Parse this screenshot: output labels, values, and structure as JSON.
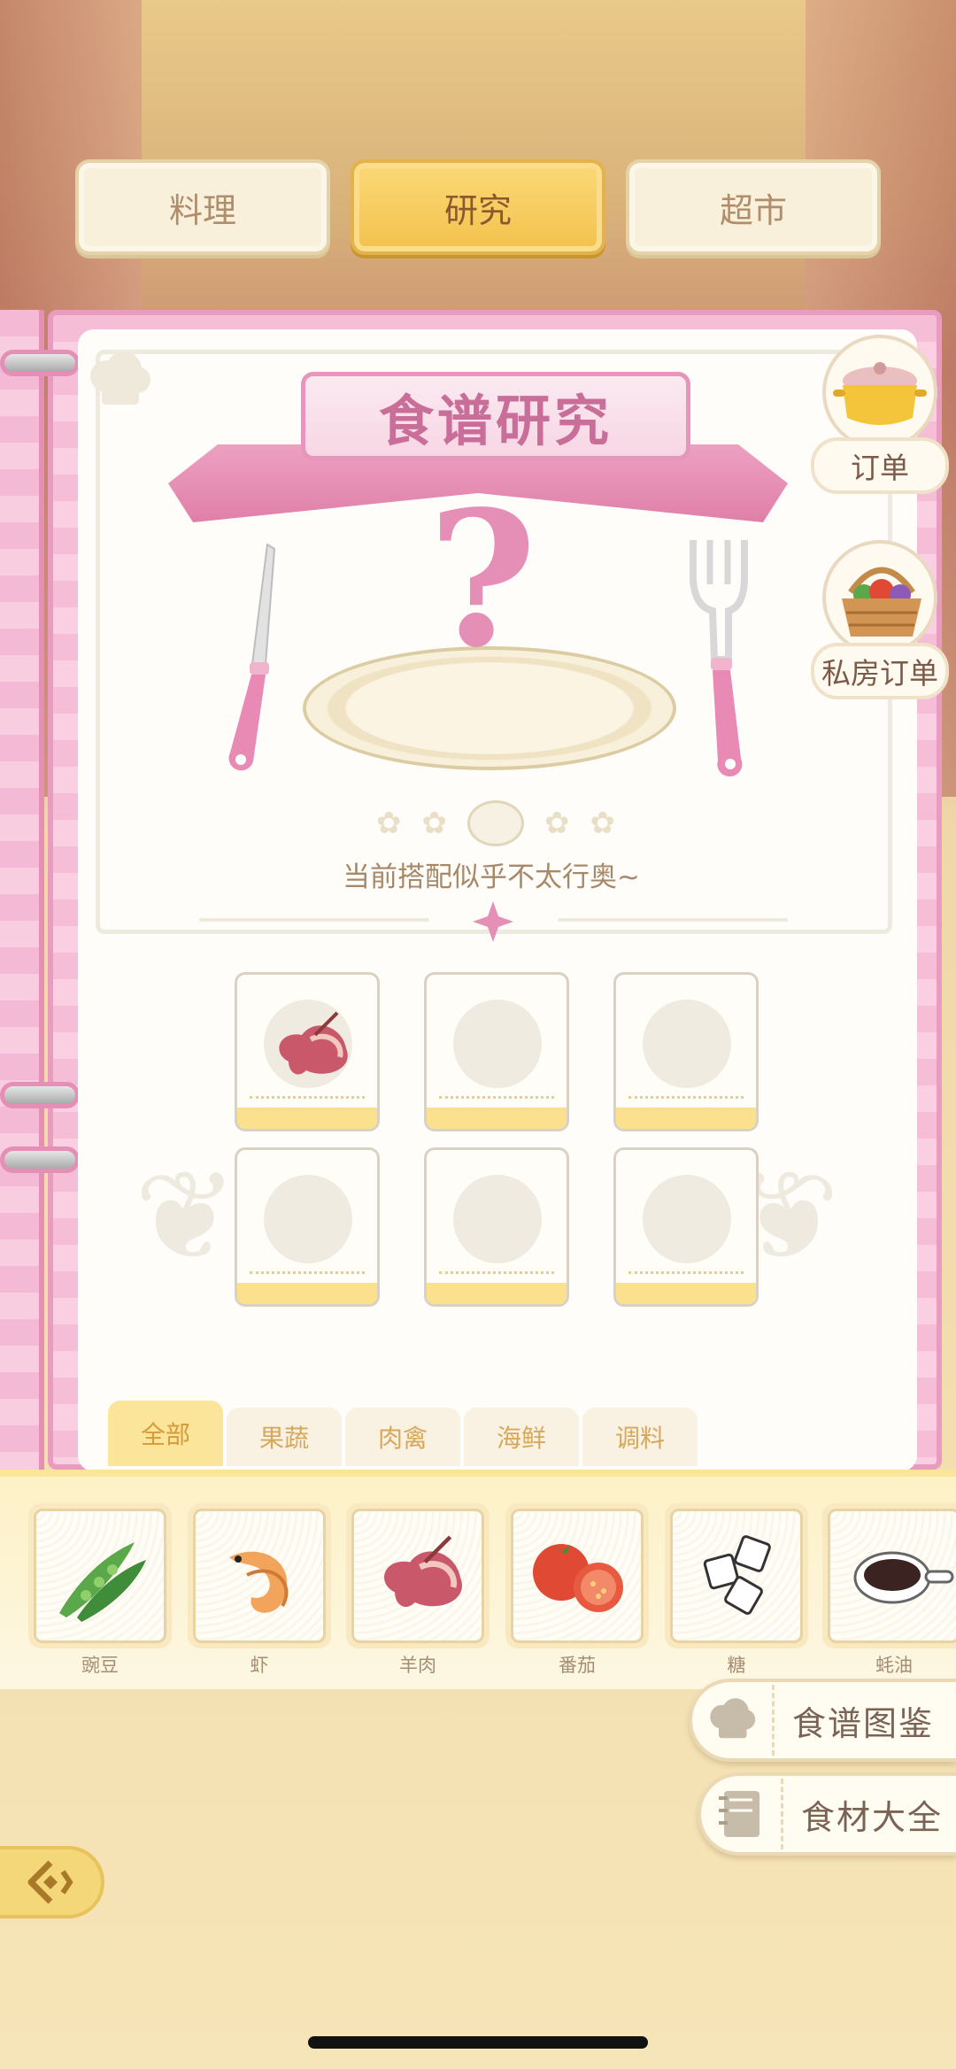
{
  "top_tabs": [
    {
      "label": "料理",
      "active": false
    },
    {
      "label": "研究",
      "active": true
    },
    {
      "label": "超市",
      "active": false
    }
  ],
  "research": {
    "title": "食谱研究",
    "mystery_symbol": "?",
    "hint": "当前搭配似乎不太行奥~"
  },
  "slots": [
    {
      "filled": true,
      "icon": "lamb-icon"
    },
    {
      "filled": false
    },
    {
      "filled": false
    },
    {
      "filled": false
    },
    {
      "filled": false
    },
    {
      "filled": false
    }
  ],
  "category_tabs": [
    {
      "label": "全部",
      "active": true
    },
    {
      "label": "果蔬",
      "active": false
    },
    {
      "label": "肉禽",
      "active": false
    },
    {
      "label": "海鲜",
      "active": false
    },
    {
      "label": "调料",
      "active": false
    }
  ],
  "ingredients": [
    {
      "name": "豌豆",
      "icon": "peas-icon"
    },
    {
      "name": "虾",
      "icon": "shrimp-icon"
    },
    {
      "name": "羊肉",
      "icon": "lamb-icon"
    },
    {
      "name": "番茄",
      "icon": "tomato-icon"
    },
    {
      "name": "糖",
      "icon": "sugar-icon"
    },
    {
      "name": "蚝油",
      "icon": "oyster-sauce-icon"
    }
  ],
  "side": {
    "order_label": "订单",
    "private_order_label": "私房订单"
  },
  "actions": {
    "recipe_book": "食谱图鉴",
    "ingredient_book": "食材大全"
  },
  "colors": {
    "accent_pink": "#e58fb6",
    "accent_yellow": "#f3c14c"
  }
}
